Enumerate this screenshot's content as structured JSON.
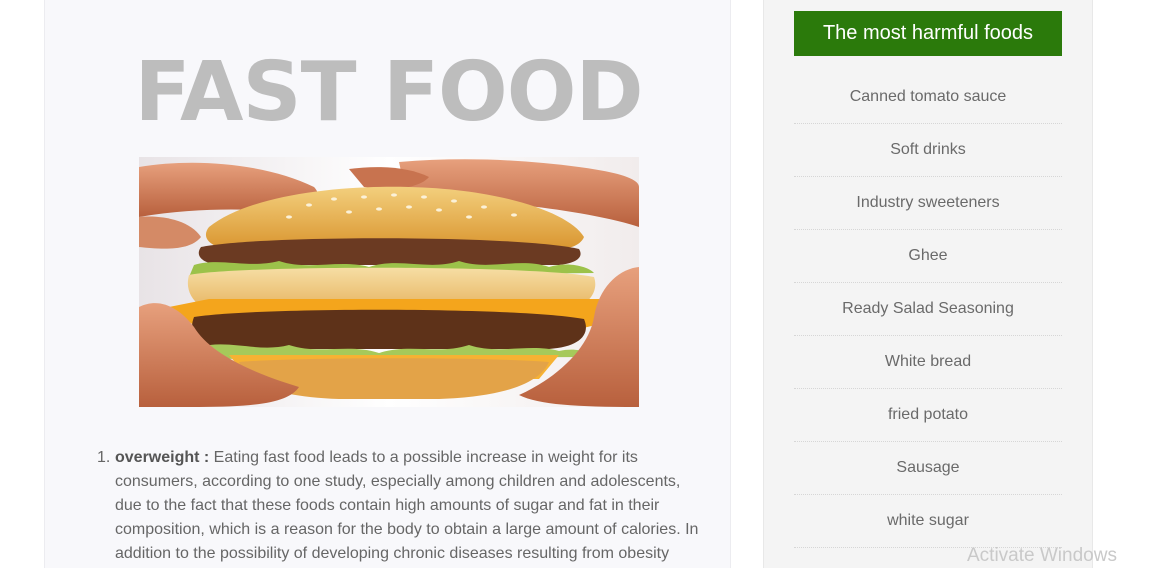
{
  "article": {
    "title": "FAST FOOD",
    "image_alt": "Hands holding a double-decker burger",
    "reasons": [
      {
        "number": "1.",
        "term": "overweight :",
        "text": " Eating fast food leads to a possible increase in weight for its consumers, according to one study, especially among children and adolescents, due to the fact that these foods contain high amounts of sugar and fat in their composition, which is a reason for the body to obtain a large amount of calories. In addition to the possibility of developing chronic diseases resulting from obesity"
      }
    ]
  },
  "sidebar": {
    "heading": "The most harmful foods",
    "items": [
      "Canned tomato sauce",
      "Soft drinks",
      "Industry sweeteners",
      "Ghee",
      "Ready Salad Seasoning",
      "White bread",
      "fried potato",
      "Sausage",
      "white sugar"
    ]
  },
  "watermark": "Activate Windows",
  "colors": {
    "heading_bg": "#2b7a0b",
    "title": "#bdbdbd",
    "body_text": "#666666"
  }
}
